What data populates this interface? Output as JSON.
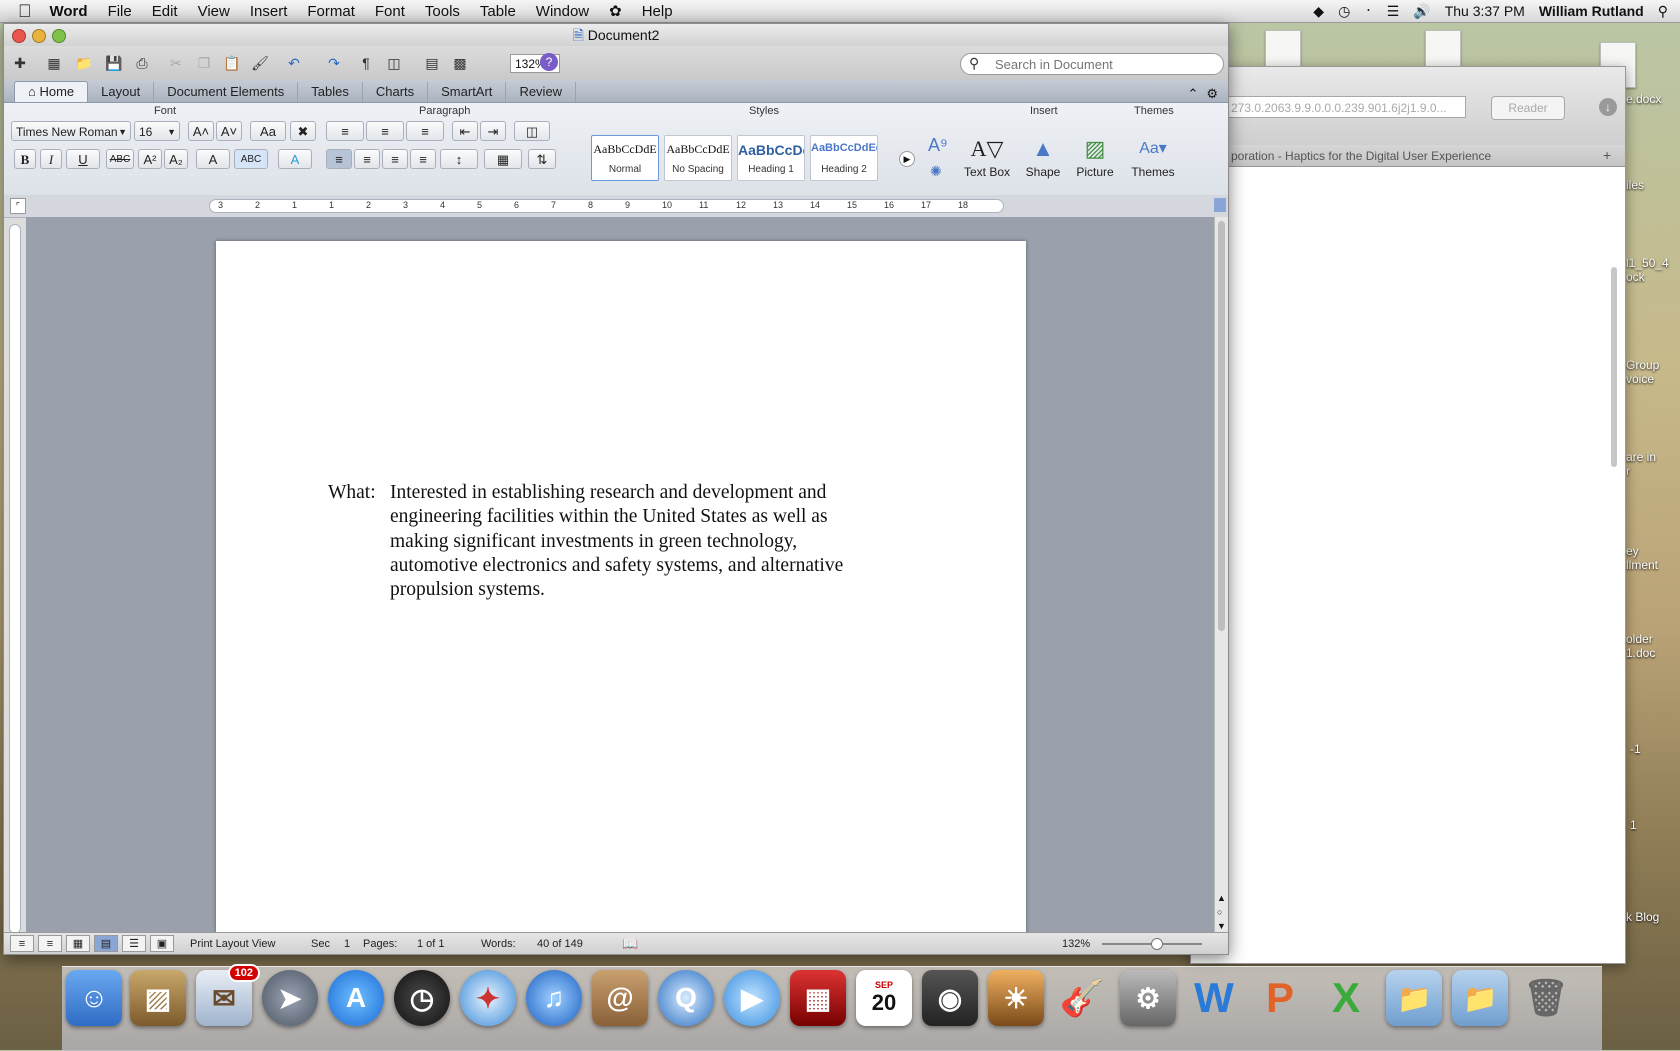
{
  "menubar": {
    "app": "Word",
    "items": [
      "File",
      "Edit",
      "View",
      "Insert",
      "Format",
      "Font",
      "Tools",
      "Table",
      "Window",
      "Help"
    ],
    "clock": "Thu 3:37 PM",
    "user": "William Rutland"
  },
  "desktop": {
    "labels": [
      "e.docx",
      "iles",
      "l1_50_4\nock",
      "Group\nvoice",
      "are in\nr",
      "ey\nllment",
      "older\n1.doc",
      "-1",
      "1",
      "k Blog"
    ]
  },
  "browser": {
    "url": "273.0.2063.9.9.0.0.0.239.901.6j2j1.9.0...",
    "reader": "Reader",
    "tab_title": "poration - Haptics for the Digital User Experience"
  },
  "word": {
    "title": "Document2",
    "zoom": "132%",
    "search_placeholder": "Search in Document",
    "tabs": [
      "Home",
      "Layout",
      "Document Elements",
      "Tables",
      "Charts",
      "SmartArt",
      "Review"
    ],
    "groups": {
      "font": "Font",
      "paragraph": "Paragraph",
      "styles": "Styles",
      "insert": "Insert",
      "themes": "Themes"
    },
    "font_name": "Times New Roman",
    "font_size": "16",
    "styles": [
      {
        "preview": "AaBbCcDdE",
        "name": "Normal"
      },
      {
        "preview": "AaBbCcDdE",
        "name": "No Spacing"
      },
      {
        "preview": "AaBbCcDd",
        "name": "Heading 1"
      },
      {
        "preview": "AaBbCcDdEe",
        "name": "Heading 2"
      }
    ],
    "insert_buttons": [
      "Text Box",
      "Shape",
      "Picture"
    ],
    "themes_button": "Themes",
    "ruler_numbers": [
      "3",
      "2",
      "1",
      "1",
      "2",
      "3",
      "4",
      "5",
      "6",
      "7",
      "8",
      "9",
      "10",
      "11",
      "12",
      "13",
      "14",
      "15",
      "16",
      "17",
      "18"
    ],
    "document": {
      "label": "What:",
      "text": "Interested in establishing research and development and engineering facilities within the United States as well as making significant investments in green technology, automotive electronics and safety systems, and alternative propulsion systems."
    },
    "status": {
      "view": "Print Layout View",
      "sec_label": "Sec",
      "sec_value": "1",
      "pages_label": "Pages:",
      "pages_value": "1 of 1",
      "words_label": "Words:",
      "words_value": "40 of 149",
      "zoom": "132%"
    }
  },
  "dock": {
    "mail_badge": "102",
    "calendar_month": "SEP",
    "calendar_day": "20"
  },
  "colors": {
    "ribbon_bg": "#e5e9ef",
    "doc_bg": "#9aa1ad",
    "accent": "#4b79c8"
  }
}
